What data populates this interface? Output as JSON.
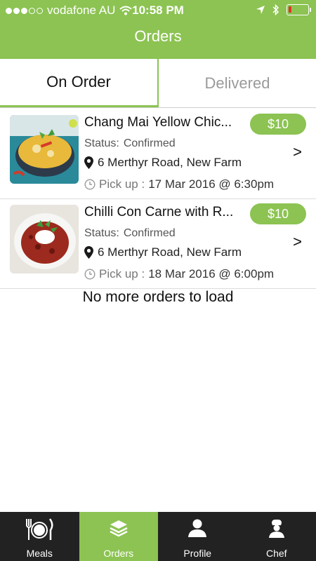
{
  "status_bar": {
    "carrier": "vodafone AU",
    "time": "10:58 PM",
    "signal_bars_filled": 3,
    "signal_bars_total": 5,
    "battery_level": 0.15
  },
  "header": {
    "title": "Orders"
  },
  "tabs": [
    {
      "label": "On Order",
      "active": true
    },
    {
      "label": "Delivered",
      "active": false
    }
  ],
  "orders": [
    {
      "title": "Chang Mai Yellow Chic...",
      "price": "$10",
      "status_label": "Status:",
      "status_value": "Confirmed",
      "address": "6 Merthyr Road, New Farm",
      "pickup_prefix": "Pick up :",
      "pickup_value": "17 Mar 2016 @ 6:30pm",
      "thumbnail_icon": "yellow-curry-photo"
    },
    {
      "title": "Chilli Con Carne with R...",
      "price": "$10",
      "status_label": "Status:",
      "status_value": "Confirmed",
      "address": "6 Merthyr Road, New Farm",
      "pickup_prefix": "Pick up :",
      "pickup_value": "18 Mar 2016 @ 6:00pm",
      "thumbnail_icon": "chilli-con-carne-photo"
    }
  ],
  "chevron": ">",
  "footer_message": "No more orders to load",
  "tab_bar": [
    {
      "label": "Meals",
      "icon": "fork-plate-knife-icon",
      "active": false
    },
    {
      "label": "Orders",
      "icon": "stack-layers-icon",
      "active": true
    },
    {
      "label": "Profile",
      "icon": "person-icon",
      "active": false
    },
    {
      "label": "Chef",
      "icon": "chef-icon",
      "active": false
    }
  ],
  "colors": {
    "brand_green": "#8cc352",
    "tabbar_dark": "#222222",
    "battery_low": "#e0342c"
  }
}
